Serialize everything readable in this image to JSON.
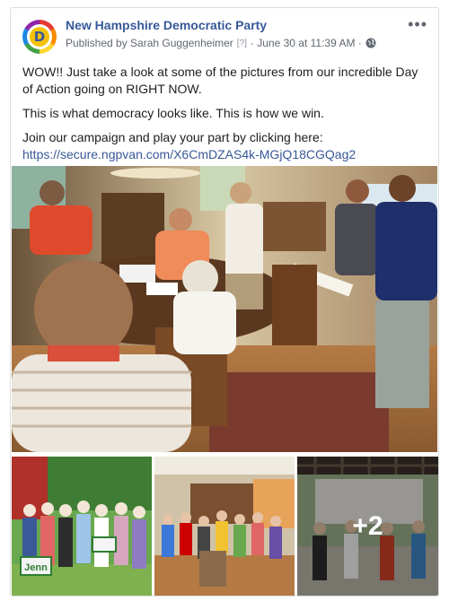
{
  "post": {
    "page_name": "New Hampshire Democratic Party",
    "published_by": "Published by Sarah Guggenheimer",
    "help_mark": "[?]",
    "timestamp": "· June 30 at 11:39 AM ·",
    "more_label": "•••",
    "avatar_letter": "D",
    "icons": [
      "page-avatar-icon",
      "globe-icon",
      "more-options-icon"
    ],
    "paragraphs": [
      "WOW!! Just take a look at some of the pictures from our incredible Day of Action going on RIGHT NOW.",
      "This is what democracy looks like. This is how we win.",
      "Join our campaign and play your part by clicking here:"
    ],
    "link": "https://secure.ngpvan.com/X6CmDZAS4k-MGjQ18CGQag2"
  },
  "photos": {
    "main_alt": "Volunteers reading scripts in a living room",
    "thumb1_sign": "Jenn",
    "more_count": "+2"
  },
  "colors": {
    "link": "#385898",
    "page_name": "#365899",
    "meta": "#606770"
  }
}
